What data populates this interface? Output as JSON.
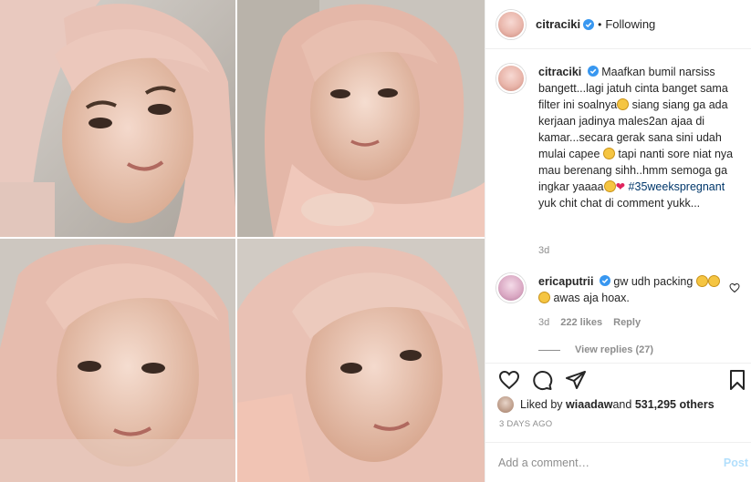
{
  "post": {
    "photos": [
      {
        "alt": "selfie 1"
      },
      {
        "alt": "selfie 2"
      },
      {
        "alt": "selfie 3"
      },
      {
        "alt": "selfie 4"
      }
    ]
  },
  "header": {
    "username": "citraciki",
    "separator": "•",
    "follow_status": "Following"
  },
  "caption": {
    "username": "citraciki",
    "text_1": "Maafkan bumil narsiss bangett...lagi jatuh cinta banget sama filter ini soalnya",
    "text_2": " siang siang ga ada kerjaan jadinya males2an ajaa di kamar...secara gerak sana sini udah mulai capee ",
    "text_3": " tapi nanti sore niat nya mau berenang sihh..hmm semoga ga ingkar yaaaa",
    "heart": "❤",
    "hashtag": "#35weekspregnant",
    "text_4": " yuk chit chat di comment yukk...",
    "time": "3d"
  },
  "comment": {
    "username": "ericaputrii",
    "text_1": " gw udh packing ",
    "text_2": " awas aja hoax.",
    "time": "3d",
    "likes": "222 likes",
    "reply": "Reply",
    "view_replies": "View replies (27)"
  },
  "likes": {
    "prefix": "Liked by ",
    "user": "wiaadaw",
    "and": " and ",
    "count": "531,295 others"
  },
  "date": "3 DAYS AGO",
  "add_comment": {
    "placeholder": "Add a comment…",
    "post_label": "Post"
  },
  "icons": {
    "like": "heart-outline",
    "comment": "speech-bubble",
    "share": "paper-plane",
    "save": "bookmark",
    "verified": "verified-badge"
  },
  "colors": {
    "verified": "#3897f0",
    "link": "#00376b",
    "muted": "#8e8e8e",
    "post_disabled": "#b2dffc"
  }
}
